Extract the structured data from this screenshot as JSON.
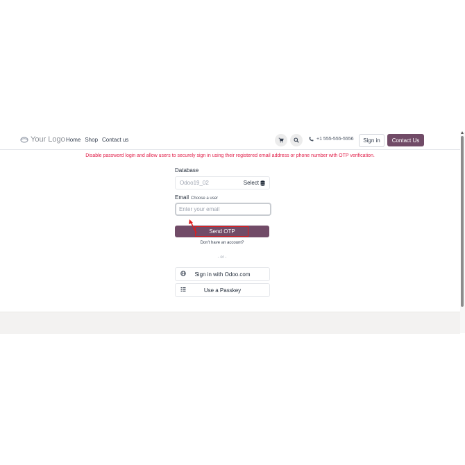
{
  "navbar": {
    "logo_text": "Your Logo",
    "links": [
      "Home",
      "Shop",
      "Contact us"
    ],
    "phone": "+1 555-555-5556",
    "signin_label": "Sign in",
    "contact_label": "Contact Us"
  },
  "notice": "Disable password login and allow users to securely sign in using their registered email address or phone number with OTP verification.",
  "form": {
    "database_label": "Database",
    "database_value": "Odoo19_02",
    "select_label": "Select",
    "email_label": "Email",
    "email_hint": "Choose a user",
    "email_placeholder": "Enter your email",
    "send_label": "Send OTP",
    "signup_text": "Don't have an account?",
    "or_text": "- or -",
    "odoo_signin_label": "Sign in with Odoo.com",
    "passkey_label": "Use a Passkey"
  },
  "colors": {
    "brand": "#714b67",
    "notice_red": "#e11d48",
    "annotation_red": "#e11d1d"
  },
  "icons": [
    "logo-icon",
    "cart-icon",
    "search-icon",
    "phone-icon",
    "database-icon",
    "globe-icon",
    "passkey-icon"
  ]
}
